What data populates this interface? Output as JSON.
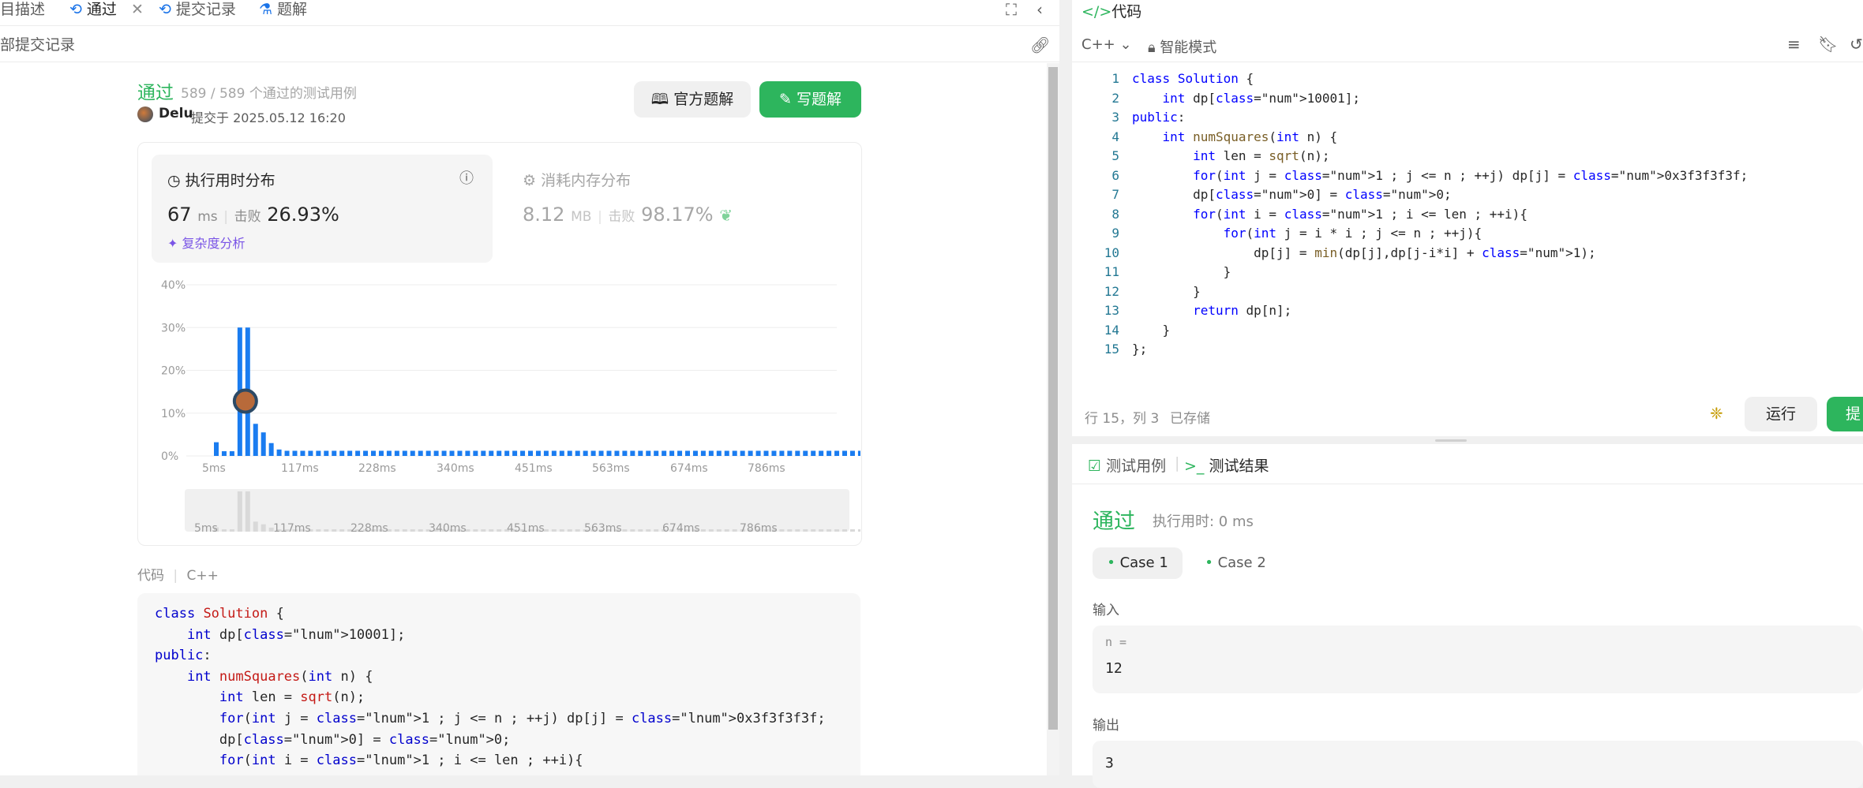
{
  "tabs": {
    "description": "目描述",
    "accepted": "通过",
    "submissions": "提交记录",
    "solutions": "题解"
  },
  "subbar": {
    "all_submissions": "部提交记录"
  },
  "result": {
    "status": "通过",
    "tests": "589 / 589 个通过的测试用例",
    "user": "Delu",
    "submitted": "提交于 2025.05.12 16:20",
    "official_solution": "官方题解",
    "write_solution": "写题解"
  },
  "runtime": {
    "title": "执行用时分布",
    "value": "67",
    "unit": "ms",
    "beats_label": "击败",
    "beats": "26.93%",
    "complexity": "复杂度分析"
  },
  "memory": {
    "title": "消耗内存分布",
    "value": "8.12",
    "unit": "MB",
    "beats_label": "击败",
    "beats": "98.17%"
  },
  "chart_data": {
    "type": "bar",
    "title": "",
    "xlabel": "",
    "ylabel": "",
    "yticks": [
      "0%",
      "10%",
      "20%",
      "30%",
      "40%"
    ],
    "ylim": [
      0,
      40
    ],
    "xticks": [
      "5ms",
      "117ms",
      "228ms",
      "340ms",
      "451ms",
      "563ms",
      "674ms",
      "786ms"
    ],
    "values": [
      3.2,
      1.1,
      1.1,
      30,
      30,
      7.5,
      5.5,
      3,
      1.5,
      1.2,
      1.2,
      1.2,
      1.2,
      1.2,
      1.2,
      1.2,
      1.2,
      1.2,
      1.2,
      1.2,
      1.2,
      1.2,
      1.2,
      1.2,
      1.2,
      1.2,
      1.2,
      1.2,
      1.2,
      1.2,
      1.2,
      1.2,
      1.2,
      1.2,
      1.2,
      1.2,
      1.2,
      1.2,
      1.2,
      1.2,
      1.2,
      1.2,
      1.2,
      1.2,
      1.2,
      1.2,
      1.2,
      1.2,
      1.2,
      1.2,
      1.2,
      1.2,
      1.2,
      1.2,
      1.2,
      1.2,
      1.2,
      1.2,
      1.2,
      1.2,
      1.2,
      1.2,
      1.2,
      1.2,
      1.2,
      1.2,
      1.2,
      1.2,
      1.2,
      1.2,
      1.2,
      1.2,
      1.2,
      1.2,
      1.2,
      1.2,
      1.2,
      1.2,
      1.2,
      1.2,
      1.2,
      1.2,
      1.2
    ],
    "highlight_index": 3,
    "grid": true,
    "color": "#1a7cf0"
  },
  "code_section": {
    "label": "代码",
    "lang": "C++"
  },
  "left_code": [
    "class Solution {",
    "    int dp[10001];",
    "public:",
    "    int numSquares(int n) {",
    "        int len = sqrt(n);",
    "        for(int j = 1 ; j <= n ; ++j) dp[j] = 0x3f3f3f3f;",
    "        dp[0] = 0;",
    "        for(int i = 1 ; i <= len ; ++i){"
  ],
  "editor": {
    "title": "代码",
    "lang": "C++",
    "mode": "智能模式",
    "status": "行 15，列 3",
    "saved": "已存储",
    "run": "运行",
    "submit": "提",
    "lines": [
      "class Solution {",
      "    int dp[10001];",
      "public:",
      "    int numSquares(int n) {",
      "        int len = sqrt(n);",
      "        for(int j = 1 ; j <= n ; ++j) dp[j] = 0x3f3f3f3f;",
      "        dp[0] = 0;",
      "        for(int i = 1 ; i <= len ; ++i){",
      "            for(int j = i * i ; j <= n ; ++j){",
      "                dp[j] = min(dp[j],dp[j-i*i] + 1);",
      "            }",
      "        }",
      "        return dp[n];",
      "    }",
      "};"
    ],
    "line_numbers": [
      "1",
      "2",
      "3",
      "4",
      "5",
      "6",
      "7",
      "8",
      "9",
      "10",
      "11",
      "12",
      "13",
      "14",
      "15"
    ]
  },
  "test_panel": {
    "tab_cases": "测试用例",
    "tab_result": "测试结果",
    "status": "通过",
    "runtime": "执行用时: 0 ms",
    "case1": "Case 1",
    "case2": "Case 2",
    "input_label": "输入",
    "input_var": "n =",
    "input_value": "12",
    "output_label": "输出",
    "output_value": "3"
  }
}
